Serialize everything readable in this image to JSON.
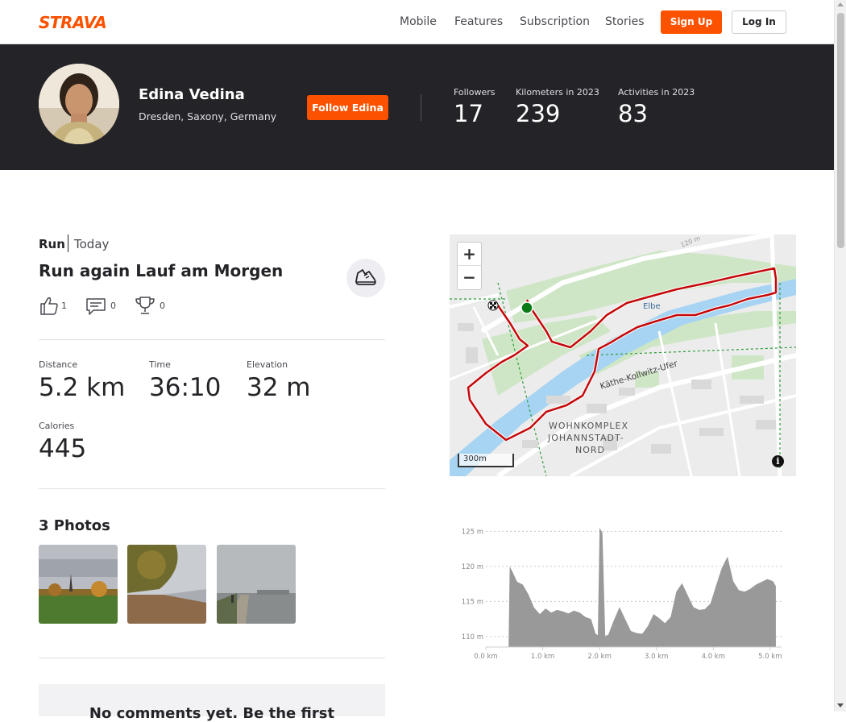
{
  "nav": {
    "logo": "STRAVA",
    "links": [
      "Mobile",
      "Features",
      "Subscription",
      "Stories"
    ],
    "signup": "Sign Up",
    "login": "Log In"
  },
  "athlete": {
    "name": "Edina Vedina",
    "location": "Dresden, Saxony, Germany",
    "follow": "Follow Edina",
    "stats": [
      {
        "label": "Followers",
        "value": "17"
      },
      {
        "label": "Kilometers in 2023",
        "value": "239"
      },
      {
        "label": "Activities in 2023",
        "value": "83"
      }
    ]
  },
  "activity": {
    "type": "Run",
    "date": "Today",
    "title": "Run again Lauf am Morgen",
    "kudos": "1",
    "comments": "0",
    "achievements": "0",
    "metrics": [
      {
        "label": "Distance",
        "value": "5.2 km"
      },
      {
        "label": "Time",
        "value": "36:10"
      },
      {
        "label": "Elevation",
        "value": "32 m"
      },
      {
        "label": "Calories",
        "value": "445"
      }
    ]
  },
  "photos": {
    "title": "3 Photos"
  },
  "comments_box": {
    "empty_text": "No comments yet. Be the first"
  },
  "map": {
    "zoom_in": "+",
    "zoom_out": "−",
    "scale": "300m",
    "info": "i",
    "labels": {
      "river": "Elbe",
      "street": "Käthe-Kollwitz-Ufer",
      "district_1": "WOHNKOMPLEX",
      "district_2": "JOHANNSTADT-",
      "district_3": "NORD",
      "contour": "120 m"
    },
    "route_color": "#c4080a",
    "start_color": "#0a7a17"
  },
  "chart_data": {
    "type": "area",
    "title": "",
    "xlabel": "",
    "ylabel": "",
    "x_ticks": [
      "0.0 km",
      "1.0 km",
      "2.0 km",
      "3.0 km",
      "4.0 km",
      "5.0 km"
    ],
    "y_ticks": [
      "110 m",
      "115 m",
      "120 m",
      "125 m"
    ],
    "xlim": [
      0,
      5.2
    ],
    "ylim": [
      108.5,
      125.5
    ],
    "grid": true,
    "fill": "#999999",
    "series": [
      {
        "x": [
          0.4,
          0.42,
          0.47,
          0.55,
          0.65,
          0.75,
          0.85,
          0.95,
          1.05,
          1.15,
          1.25,
          1.35,
          1.45,
          1.55,
          1.65,
          1.75,
          1.85,
          1.93,
          1.97,
          2.0,
          2.05,
          2.1,
          2.12,
          2.15,
          2.25,
          2.35,
          2.45,
          2.55,
          2.65,
          2.75,
          2.85,
          2.95,
          3.05,
          3.15,
          3.25,
          3.35,
          3.45,
          3.55,
          3.65,
          3.75,
          3.85,
          3.95,
          4.05,
          4.15,
          4.25,
          4.35,
          4.45,
          4.55,
          4.65,
          4.75,
          4.85,
          4.95,
          5.05,
          5.1
        ],
        "y": [
          108.5,
          120.0,
          119.2,
          117.8,
          117.4,
          116.0,
          114.1,
          113.2,
          114.0,
          113.4,
          113.8,
          113.6,
          113.3,
          113.7,
          113.4,
          112.8,
          112.5,
          110.4,
          110.2,
          125.5,
          124.8,
          110.0,
          110.2,
          110.2,
          112.3,
          114.2,
          112.5,
          110.8,
          110.5,
          110.4,
          111.5,
          113.2,
          112.6,
          111.9,
          112.8,
          116.4,
          117.6,
          115.9,
          114.2,
          113.8,
          113.9,
          114.7,
          117.3,
          119.8,
          121.4,
          117.9,
          116.6,
          116.4,
          116.8,
          117.4,
          117.8,
          118.2,
          117.9,
          117.2
        ]
      }
    ]
  }
}
